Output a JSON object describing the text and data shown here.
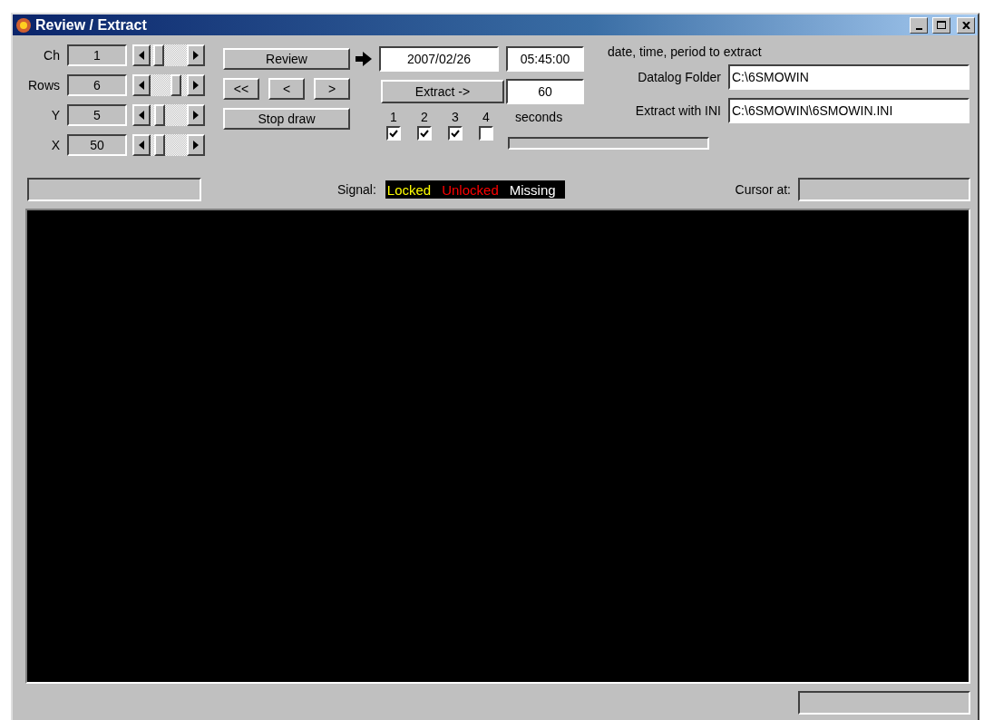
{
  "window": {
    "title": "Review / Extract"
  },
  "sliders": [
    {
      "label": "Ch",
      "value": "1",
      "level": 0.1
    },
    {
      "label": "Rows",
      "value": "6",
      "level": 0.8
    },
    {
      "label": "Y",
      "value": "5",
      "level": 0.15
    },
    {
      "label": "X",
      "value": "50",
      "level": 0.15
    }
  ],
  "review_button": "Review",
  "nav_buttons": [
    "<<",
    "<",
    ">"
  ],
  "stop_button": "Stop draw",
  "period": {
    "date": "2007/02/26",
    "time": "05:45:00",
    "extract_button": "Extract ->",
    "seconds_value": "60",
    "seconds_label": "seconds",
    "hint": "date, time, period to extract"
  },
  "channels": [
    {
      "label": "1",
      "checked": true
    },
    {
      "label": "2",
      "checked": true
    },
    {
      "label": "3",
      "checked": true
    },
    {
      "label": "4",
      "checked": false
    }
  ],
  "progress": {
    "level": 0
  },
  "datalog_folder": {
    "label": "Datalog Folder",
    "value": "C:\\6SMOWIN"
  },
  "extract_ini": {
    "label": "Extract with INI",
    "value": "C:\\6SMOWIN\\6SMOWIN.INI"
  },
  "signal": {
    "label": "Signal:",
    "legend": [
      {
        "text": "Locked",
        "kind": "locked"
      },
      {
        "text": "Unlocked",
        "kind": "unlocked"
      },
      {
        "text": "Missing",
        "kind": "missing"
      }
    ]
  },
  "cursor": {
    "label": "Cursor at:"
  }
}
